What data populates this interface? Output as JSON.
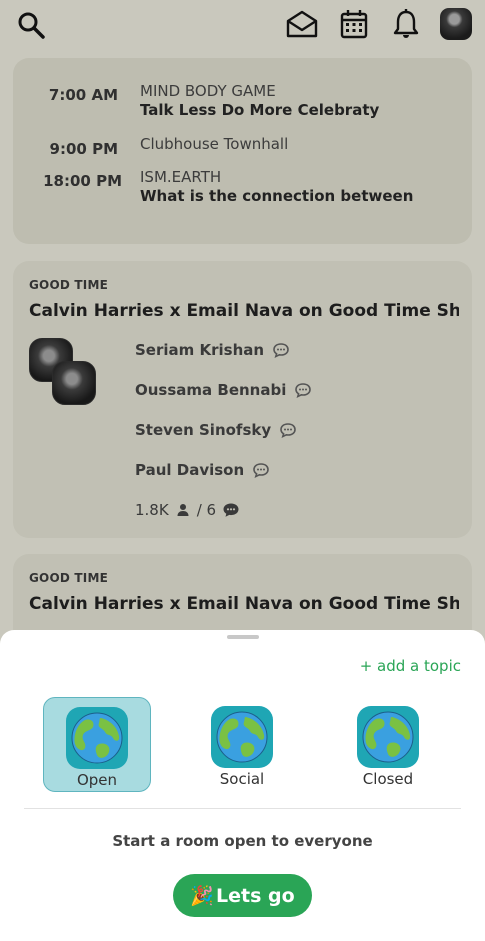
{
  "header": {
    "icons": [
      "search-icon",
      "envelope-icon",
      "calendar-icon",
      "bell-icon",
      "avatar"
    ]
  },
  "schedule": [
    {
      "time": "7:00 AM",
      "club": "MIND BODY GAME",
      "title": "Talk Less Do More Celebraty"
    },
    {
      "time": "9:00 PM",
      "club": "Clubhouse Townhall",
      "title": ""
    },
    {
      "time": "18:00 PM",
      "club": "ISM.EARTH",
      "title": "What is the connection between"
    }
  ],
  "rooms": [
    {
      "club": "GOOD TIME",
      "title": "Calvin Harries x Email Nava on Good Time Showe",
      "speakers": [
        "Seriam Krishan",
        "Oussama Bennabi",
        "Steven Sinofsky",
        "Paul Davison"
      ],
      "listeners": "1.8K",
      "speaker_count": "/ 6"
    },
    {
      "club": "GOOD TIME",
      "title": "Calvin Harries x Email Nava on Good Time Showe"
    }
  ],
  "sheet": {
    "add_topic": "+ add a topic",
    "room_types": [
      {
        "label": "Open",
        "selected": true
      },
      {
        "label": "Social",
        "selected": false
      },
      {
        "label": "Closed",
        "selected": false
      }
    ],
    "description": "Start a room open to everyone",
    "button_emoji": "🎉",
    "button_label": "Lets go"
  },
  "colors": {
    "accent_green": "#2aa556",
    "selected_type_bg": "#a8dbe0",
    "dim_overlay_bg": "#c9c8bd"
  }
}
